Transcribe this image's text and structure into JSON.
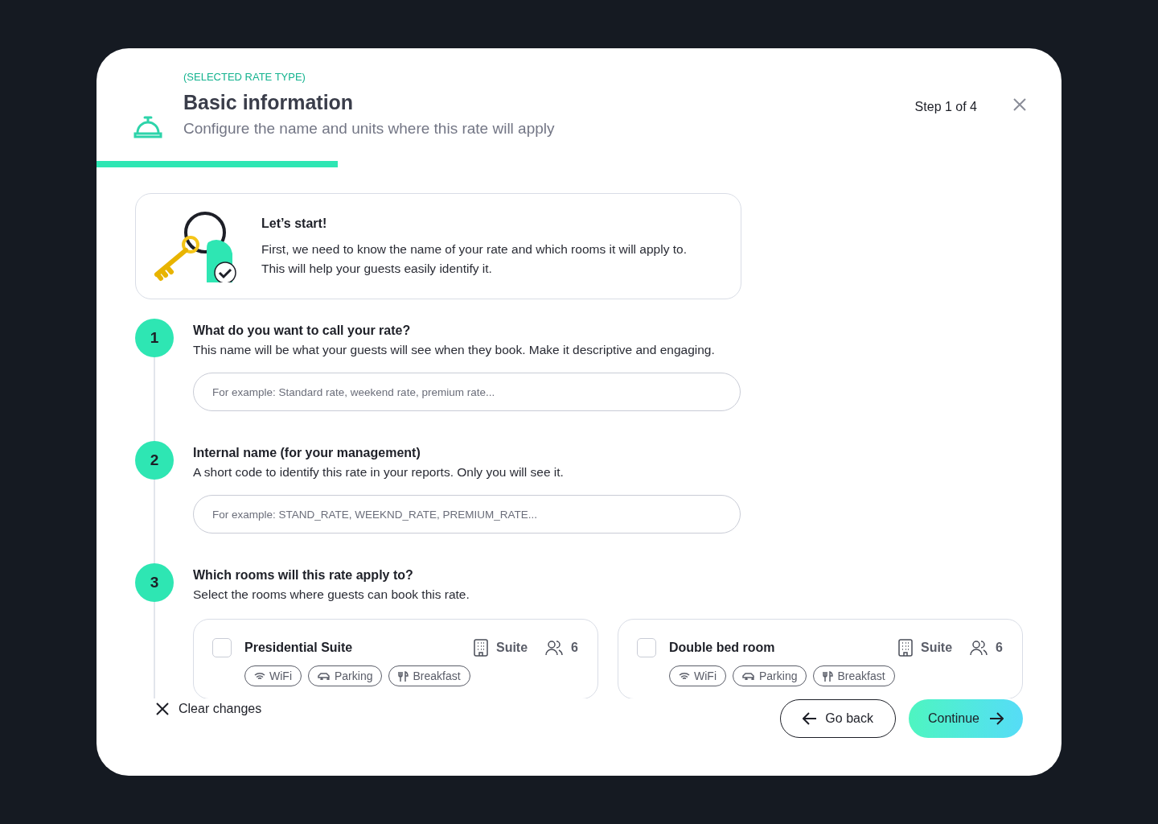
{
  "header": {
    "eyebrow": "(SELECTED RATE TYPE)",
    "title": "Basic information",
    "subtitle": "Configure the name and units where this rate will apply",
    "step": "Step 1 of 4",
    "progress": {
      "level": 0.25
    }
  },
  "intro": {
    "title": "Let’s start!",
    "lines": [
      "First, we need to know the name of your rate and which rooms it will apply to.",
      "This will help your guests easily identify it."
    ]
  },
  "steps": [
    {
      "number": "1",
      "kind": "input",
      "title": "What do you want to call your rate?",
      "description": "This name will be what your guests will see when they book. Make it descriptive and engaging.",
      "placeholder": "For example: Standard rate, weekend rate, premium rate..."
    },
    {
      "number": "2",
      "kind": "input",
      "title": "Internal name (for your management)",
      "description": "A short code to identify this rate in your reports. Only you will see it.",
      "placeholder": "For example: STAND_RATE, WEEKND_RATE, PREMIUM_RATE..."
    },
    {
      "number": "3",
      "kind": "rooms",
      "title": "Which rooms will this rate apply to?",
      "description": "Select the rooms where guests can book this rate.",
      "rooms": [
        {
          "name": "Presidential Suite",
          "checked": false,
          "type": "Suite",
          "guests": "6",
          "amenities": [
            {
              "kind": "wifi",
              "label": "WiFi"
            },
            {
              "kind": "parking",
              "label": "Parking"
            },
            {
              "kind": "breakfast",
              "label": "Breakfast"
            }
          ]
        },
        {
          "name": "Double bed room",
          "checked": false,
          "type": "Suite",
          "guests": "6",
          "amenities": [
            {
              "kind": "wifi",
              "label": "WiFi"
            },
            {
              "kind": "parking",
              "label": "Parking"
            },
            {
              "kind": "breakfast",
              "label": "Breakfast"
            }
          ]
        }
      ]
    }
  ],
  "footer": {
    "clear": "Clear changes",
    "back": "Go back",
    "continue": "Continue"
  }
}
